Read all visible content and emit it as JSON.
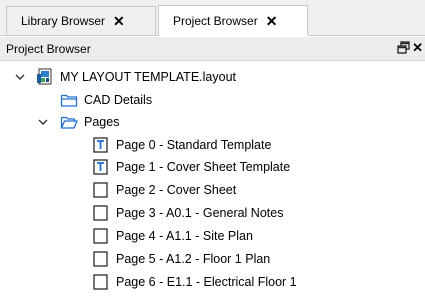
{
  "tabs": [
    {
      "label": "Library Browser",
      "close": "✕"
    },
    {
      "label": "Project Browser",
      "close": "✕"
    }
  ],
  "panel": {
    "title": "Project Browser",
    "float_icon": "float-window-icon",
    "close": "✕"
  },
  "tree": {
    "root": {
      "label": "MY LAYOUT TEMPLATE.layout",
      "icon": "layout-file-icon"
    },
    "folders": [
      {
        "label": "CAD Details",
        "icon": "folder-icon"
      },
      {
        "label": "Pages",
        "icon": "folder-open-icon"
      }
    ],
    "pages": [
      {
        "label": "Page 0 - Standard Template",
        "icon": "template-page-icon"
      },
      {
        "label": "Page 1 - Cover Sheet Template",
        "icon": "template-page-icon"
      },
      {
        "label": "Page 2 - Cover Sheet",
        "icon": "page-icon"
      },
      {
        "label": "Page 3 - A0.1 - General Notes",
        "icon": "page-icon"
      },
      {
        "label": "Page 4 - A1.1 - Site Plan",
        "icon": "page-icon"
      },
      {
        "label": "Page 5 - A1.2 - Floor 1 Plan",
        "icon": "page-icon"
      },
      {
        "label": "Page 6 - E1.1 - Electrical Floor 1",
        "icon": "page-icon"
      }
    ]
  },
  "colors": {
    "folder_outline": "#1f6fd1",
    "icon_outline": "#1a1a1a"
  }
}
